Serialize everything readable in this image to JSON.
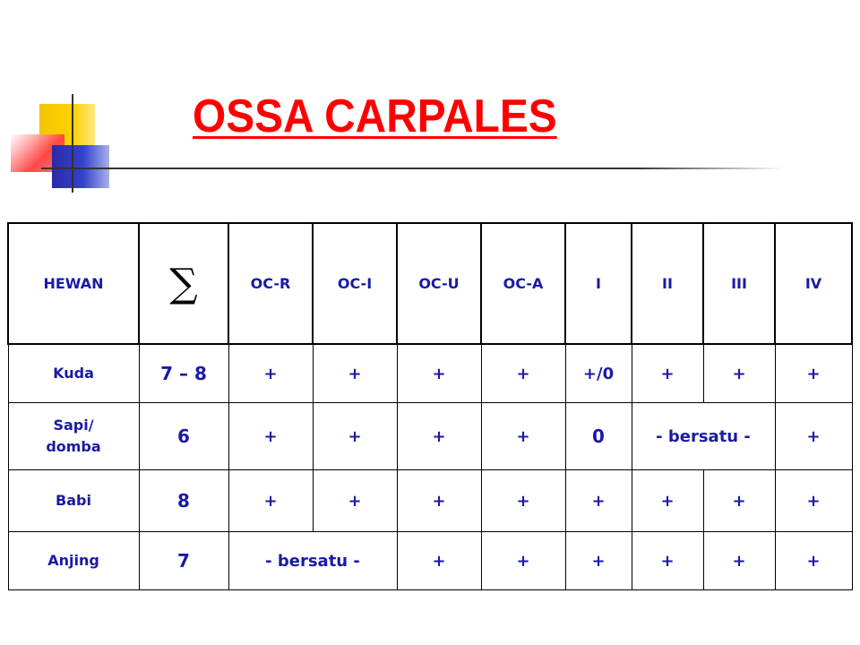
{
  "title": "OSSA CARPALES",
  "colors": {
    "title": "#ff0000",
    "cell_text": "#1a1aa6"
  },
  "table": {
    "headers": [
      "HEWAN",
      "∑",
      "OC-R",
      "OC-I",
      "OC-U",
      "OC-A",
      "I",
      "II",
      "III",
      "IV"
    ],
    "rows": [
      {
        "hewan": "Kuda",
        "sum": "7 – 8",
        "cells": [
          "+",
          "+",
          "+",
          "+",
          "+/0",
          "+",
          "+",
          "+"
        ]
      },
      {
        "hewan_line1": "Sapi/",
        "hewan_line2": "domba",
        "sum": "6",
        "cells": [
          "+",
          "+",
          "+",
          "+",
          "0"
        ],
        "merged": "- bersatu -",
        "last": "+"
      },
      {
        "hewan": "Babi",
        "sum": "8",
        "cells": [
          "+",
          "+",
          "+",
          "+",
          "+",
          "+",
          "+",
          "+"
        ]
      },
      {
        "hewan": "Anjing",
        "sum": "7",
        "merged": "- bersatu -",
        "cells": [
          "+",
          "+",
          "+",
          "+",
          "+",
          "+"
        ]
      }
    ]
  }
}
